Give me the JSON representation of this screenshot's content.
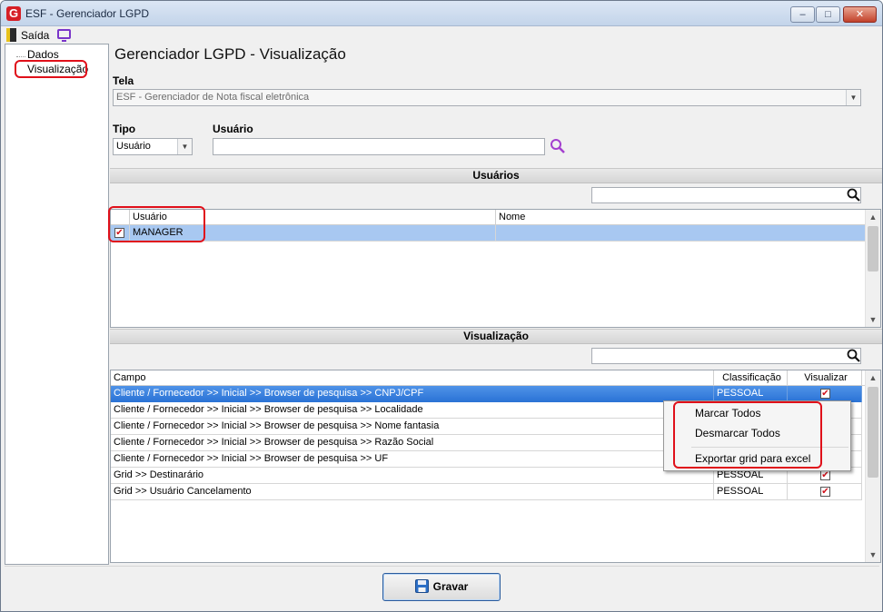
{
  "window": {
    "title": "ESF - Gerenciador LGPD",
    "icon_letter": "G",
    "buttons": {
      "minimize": "–",
      "maximize": "□",
      "close": "✕"
    }
  },
  "menu": {
    "exit_label": "Saída"
  },
  "tree": {
    "items": [
      "Dados",
      "Visualização"
    ],
    "selected": "Visualização"
  },
  "page": {
    "title": "Gerenciador LGPD - Visualização",
    "tela": {
      "label": "Tela",
      "value": "ESF - Gerenciador de Nota fiscal eletrônica"
    },
    "tipo": {
      "label": "Tipo",
      "value": "Usuário"
    },
    "usuario": {
      "label": "Usuário",
      "value": ""
    }
  },
  "users_section": {
    "header": "Usuários",
    "search_value": "",
    "columns": [
      "Usuário",
      "Nome"
    ],
    "rows": [
      {
        "checked": true,
        "usuario": "MANAGER",
        "nome": ""
      }
    ]
  },
  "vis_section": {
    "header": "Visualização",
    "search_value": "",
    "columns": [
      "Campo",
      "Classificação",
      "Visualizar"
    ],
    "rows": [
      {
        "campo": "Cliente / Fornecedor >> Inicial >> Browser de pesquisa >> CNPJ/CPF",
        "classificacao": "PESSOAL",
        "visualizar": true
      },
      {
        "campo": "Cliente / Fornecedor >> Inicial >> Browser de pesquisa >> Localidade",
        "classificacao": "",
        "visualizar": null
      },
      {
        "campo": "Cliente / Fornecedor >> Inicial >> Browser de pesquisa >> Nome fantasia",
        "classificacao": "",
        "visualizar": null
      },
      {
        "campo": "Cliente / Fornecedor >> Inicial >> Browser de pesquisa >> Razão Social",
        "classificacao": "",
        "visualizar": null
      },
      {
        "campo": "Cliente / Fornecedor >> Inicial >> Browser de pesquisa >> UF",
        "classificacao": "",
        "visualizar": null
      },
      {
        "campo": "Grid >> Destinarário",
        "classificacao": "PESSOAL",
        "visualizar": true
      },
      {
        "campo": "Grid >> Usuário Cancelamento",
        "classificacao": "PESSOAL",
        "visualizar": true
      }
    ]
  },
  "context_menu": {
    "items": [
      "Marcar Todos",
      "Desmarcar Todos",
      "Exportar grid para excel"
    ]
  },
  "actions": {
    "save_label": "Gravar"
  },
  "colors": {
    "highlight": "#e0101a",
    "selection": "#2c74d6",
    "accent_icon": "#7a35c9"
  }
}
